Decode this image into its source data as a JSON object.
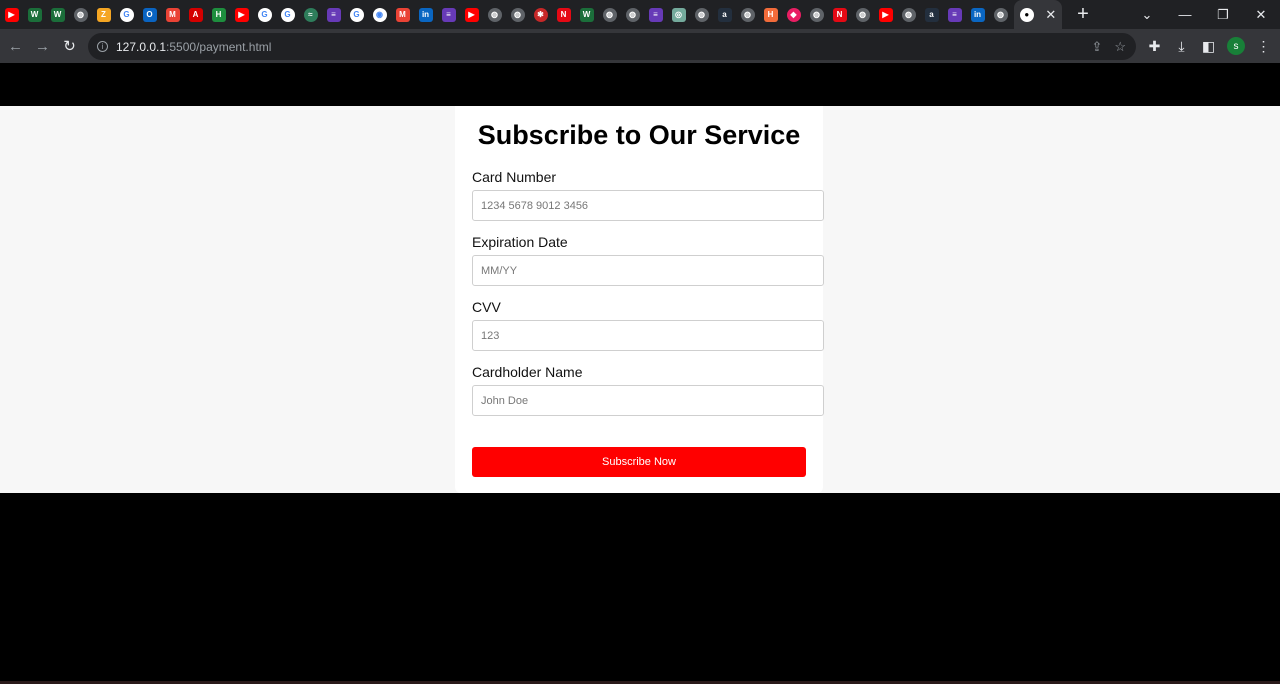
{
  "browser": {
    "pinned_tabs": [
      {
        "icon": "youtube-icon",
        "glyph": "▶",
        "bg": "#ff0000",
        "round": false
      },
      {
        "icon": "w-icon",
        "glyph": "W",
        "bg": "#1b6e3a",
        "round": false
      },
      {
        "icon": "w-icon",
        "glyph": "W",
        "bg": "#1b6e3a",
        "round": false
      },
      {
        "icon": "globe-icon",
        "glyph": "◍",
        "bg": "#5f6368",
        "round": true
      },
      {
        "icon": "zoho-icon",
        "glyph": "Z",
        "bg": "#f5a623",
        "round": false
      },
      {
        "icon": "google-icon",
        "glyph": "G",
        "bg": "#ffffff",
        "round": true
      },
      {
        "icon": "outlook-icon",
        "glyph": "O",
        "bg": "#0a64c2",
        "round": false
      },
      {
        "icon": "gmail-icon",
        "glyph": "M",
        "bg": "#ea4335",
        "round": false
      },
      {
        "icon": "pdf-icon",
        "glyph": "A",
        "bg": "#d40000",
        "round": false
      },
      {
        "icon": "hi-icon",
        "glyph": "H",
        "bg": "#1e8e3e",
        "round": false
      },
      {
        "icon": "youtube-icon",
        "glyph": "▶",
        "bg": "#ff0000",
        "round": false
      },
      {
        "icon": "google-icon",
        "glyph": "G",
        "bg": "#ffffff",
        "round": true
      },
      {
        "icon": "google-icon",
        "glyph": "G",
        "bg": "#ffffff",
        "round": true
      },
      {
        "icon": "wifi-icon",
        "glyph": "≈",
        "bg": "#2e7d5b",
        "round": true
      },
      {
        "icon": "forms-icon",
        "glyph": "≡",
        "bg": "#673ab7",
        "round": false
      },
      {
        "icon": "google-icon",
        "glyph": "G",
        "bg": "#ffffff",
        "round": true
      },
      {
        "icon": "chrome-icon",
        "glyph": "◉",
        "bg": "#ffffff",
        "round": true
      },
      {
        "icon": "gmail-icon",
        "glyph": "M",
        "bg": "#ea4335",
        "round": false
      },
      {
        "icon": "linkedin-icon",
        "glyph": "in",
        "bg": "#0a66c2",
        "round": false
      },
      {
        "icon": "forms-icon",
        "glyph": "≡",
        "bg": "#673ab7",
        "round": false
      },
      {
        "icon": "youtube-icon",
        "glyph": "▶",
        "bg": "#ff0000",
        "round": false
      },
      {
        "icon": "globe-icon",
        "glyph": "◍",
        "bg": "#5f6368",
        "round": true
      },
      {
        "icon": "globe-icon",
        "glyph": "◍",
        "bg": "#5f6368",
        "round": true
      },
      {
        "icon": "gear-icon",
        "glyph": "✱",
        "bg": "#c62828",
        "round": true
      },
      {
        "icon": "netflix-icon",
        "glyph": "N",
        "bg": "#e50914",
        "round": false
      },
      {
        "icon": "w-icon",
        "glyph": "W",
        "bg": "#1b6e3a",
        "round": false
      },
      {
        "icon": "globe-icon",
        "glyph": "◍",
        "bg": "#5f6368",
        "round": true
      },
      {
        "icon": "globe-icon",
        "glyph": "◍",
        "bg": "#5f6368",
        "round": true
      },
      {
        "icon": "forms-icon",
        "glyph": "≡",
        "bg": "#673ab7",
        "round": false
      },
      {
        "icon": "chatgpt-icon",
        "glyph": "◎",
        "bg": "#74aa9c",
        "round": false
      },
      {
        "icon": "globe-icon",
        "glyph": "◍",
        "bg": "#5f6368",
        "round": true
      },
      {
        "icon": "amazon-icon",
        "glyph": "a",
        "bg": "#232f3e",
        "round": false
      },
      {
        "icon": "globe-icon",
        "glyph": "◍",
        "bg": "#5f6368",
        "round": true
      },
      {
        "icon": "hackerrank-icon",
        "glyph": "H",
        "bg": "#f26b3a",
        "round": false
      },
      {
        "icon": "cube-icon",
        "glyph": "◆",
        "bg": "#e91e63",
        "round": true
      },
      {
        "icon": "globe-icon",
        "glyph": "◍",
        "bg": "#5f6368",
        "round": true
      },
      {
        "icon": "netflix-icon",
        "glyph": "N",
        "bg": "#e50914",
        "round": false
      },
      {
        "icon": "globe-icon",
        "glyph": "◍",
        "bg": "#5f6368",
        "round": true
      },
      {
        "icon": "youtube-icon",
        "glyph": "▶",
        "bg": "#ff0000",
        "round": false
      },
      {
        "icon": "globe-icon",
        "glyph": "◍",
        "bg": "#5f6368",
        "round": true
      },
      {
        "icon": "amazon-icon",
        "glyph": "a",
        "bg": "#232f3e",
        "round": false
      },
      {
        "icon": "forms-icon",
        "glyph": "≡",
        "bg": "#673ab7",
        "round": false
      },
      {
        "icon": "linkedin-icon",
        "glyph": "in",
        "bg": "#0a66c2",
        "round": false
      },
      {
        "icon": "globe-icon",
        "glyph": "◍",
        "bg": "#5f6368",
        "round": true
      }
    ],
    "active_tab": {
      "icon": "github-icon",
      "close_glyph": "✕"
    },
    "new_tab_glyph": "+",
    "window_controls": {
      "tabsearch": "⌄",
      "minimize": "—",
      "maximize": "❐",
      "close": "✕"
    },
    "nav": {
      "back": "←",
      "forward": "→",
      "reload": "↻"
    },
    "url_host": "127.0.0.1",
    "url_rest": ":5500/payment.html",
    "avatar_letter": "s",
    "accent": "#188038"
  },
  "form": {
    "title": "Subscribe to Our Service",
    "fields": [
      {
        "label": "Card Number",
        "placeholder": "1234 5678 9012 3456"
      },
      {
        "label": "Expiration Date",
        "placeholder": "MM/YY"
      },
      {
        "label": "CVV",
        "placeholder": "123"
      },
      {
        "label": "Cardholder Name",
        "placeholder": "John Doe"
      }
    ],
    "submit_label": "Subscribe Now",
    "submit_color": "#ff0000"
  }
}
